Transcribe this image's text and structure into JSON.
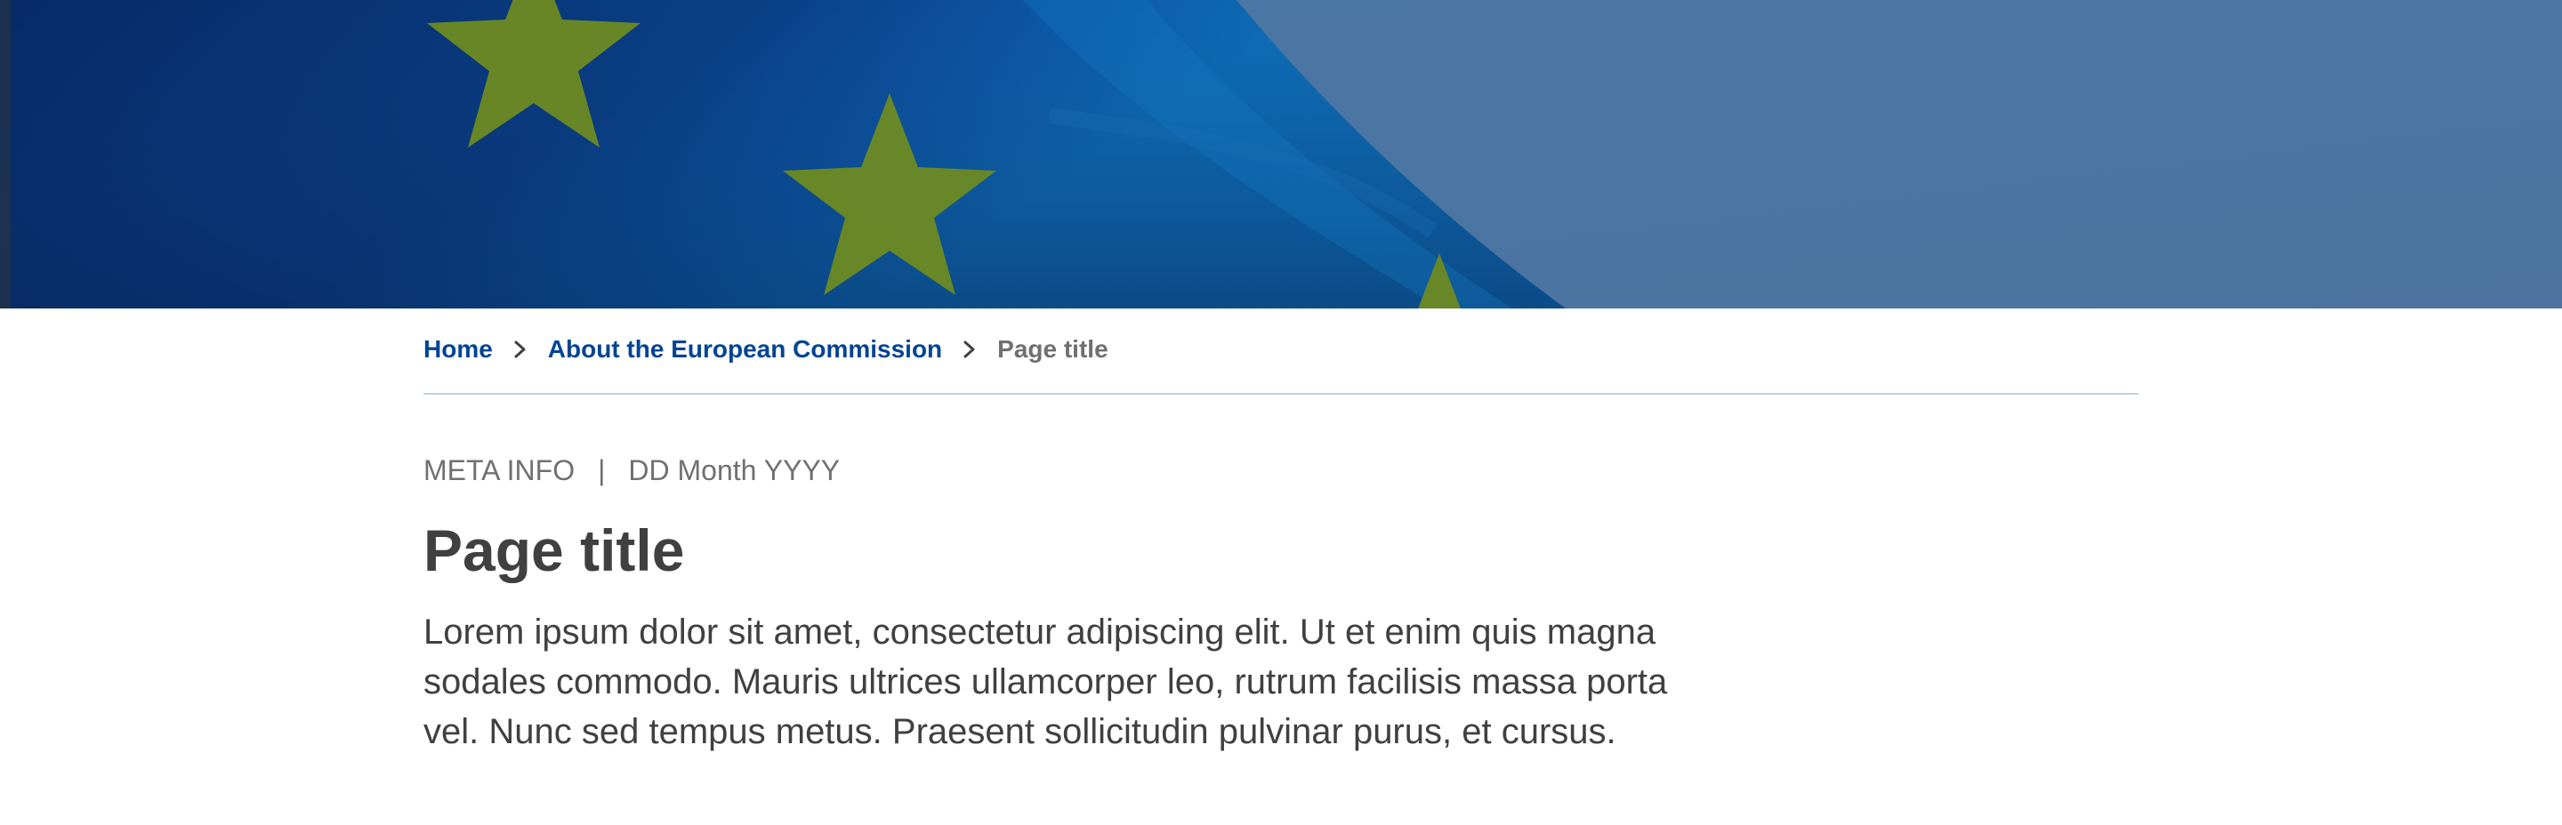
{
  "breadcrumb": {
    "items": [
      {
        "label": "Home"
      },
      {
        "label": "About the European Commission"
      }
    ],
    "current": "Page title"
  },
  "meta": {
    "type": "META INFO",
    "separator": "|",
    "date": "DD Month YYYY"
  },
  "page": {
    "title": "Page title",
    "lead": "Lorem ipsum dolor sit amet, consectetur adipiscing elit. Ut et enim quis magna sodales commodo. Mauris ultrices ullamcorper leo, rutrum facilisis massa porta vel. Nunc sed tempus metus. Praesent sollicitudin pulvinar purus, et cursus."
  },
  "colors": {
    "link": "#004494",
    "muted": "#707070",
    "text": "#404040",
    "divider": "#bfd0e4",
    "flag_blue": "#0a3a7a",
    "flag_star": "#5f7d2a",
    "hero_overlay": "#4a76a2"
  },
  "icons": {
    "breadcrumb_separator": "chevron-right-icon"
  }
}
